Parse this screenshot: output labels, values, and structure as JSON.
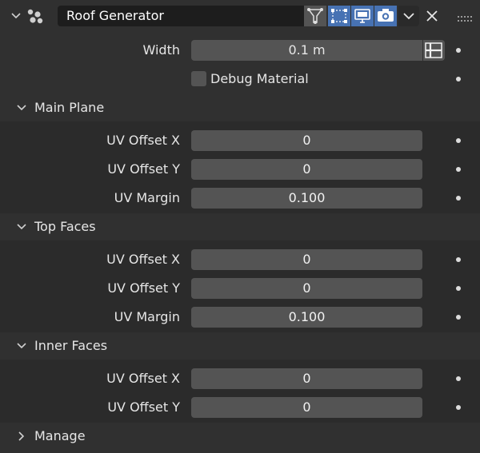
{
  "panel": {
    "title": "Roof Generator",
    "accent": "#4772b3",
    "icons": {
      "collapse": "chevron-down-icon",
      "node": "node-group-icon",
      "filter": "filter-icon",
      "edit_mode": "edit-mode-icon",
      "viewport": "monitor-icon",
      "render": "camera-icon",
      "more": "chevron-down-icon",
      "close": "close-icon",
      "drag": "drag-grip-icon"
    }
  },
  "properties": {
    "width": {
      "label": "Width",
      "value": "0.1 m"
    },
    "debug_material": {
      "label": "Debug Material",
      "checked": false
    }
  },
  "sections": {
    "main_plane": {
      "title": "Main Plane",
      "expanded": true,
      "rows": [
        {
          "label": "UV Offset X",
          "value": "0"
        },
        {
          "label": "UV Offset Y",
          "value": "0"
        },
        {
          "label": "UV Margin",
          "value": "0.100"
        }
      ]
    },
    "top_faces": {
      "title": "Top Faces",
      "expanded": true,
      "rows": [
        {
          "label": "UV Offset X",
          "value": "0"
        },
        {
          "label": "UV Offset Y",
          "value": "0"
        },
        {
          "label": "UV Margin",
          "value": "0.100"
        }
      ]
    },
    "inner_faces": {
      "title": "Inner Faces",
      "expanded": true,
      "rows": [
        {
          "label": "UV Offset X",
          "value": "0"
        },
        {
          "label": "UV Offset Y",
          "value": "0"
        }
      ]
    },
    "manage": {
      "title": "Manage",
      "expanded": false
    }
  }
}
